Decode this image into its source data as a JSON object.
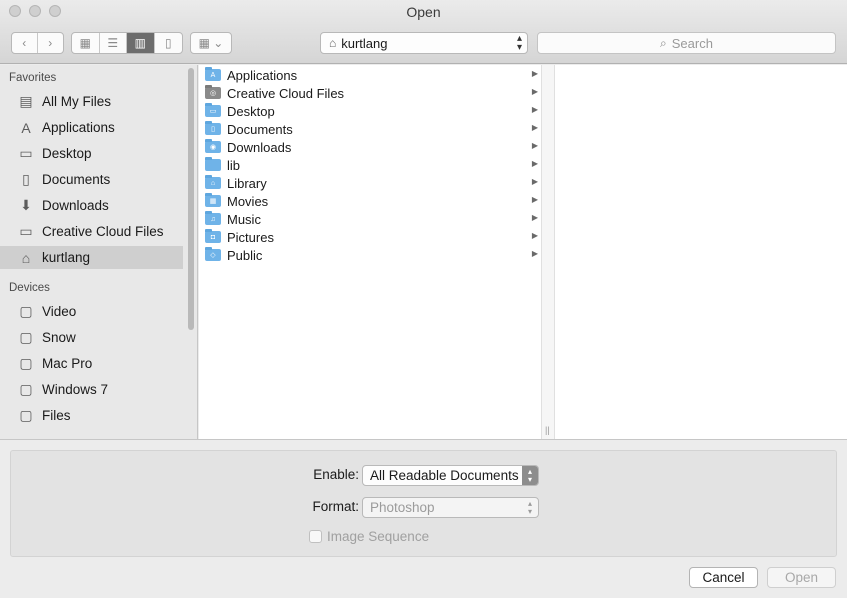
{
  "window": {
    "title": "Open"
  },
  "toolbar": {
    "back_icon": "chevron-left-icon",
    "forward_icon": "chevron-right-icon",
    "view_modes": [
      {
        "name": "icon-view",
        "glyph": "▦",
        "active": false
      },
      {
        "name": "list-view",
        "glyph": "☰",
        "active": false
      },
      {
        "name": "column-view",
        "glyph": "▥",
        "active": true
      },
      {
        "name": "cover-flow-view",
        "glyph": "▯",
        "active": false
      }
    ],
    "arrange_glyph": "▦ ⌄",
    "location": "kurtlang",
    "search_placeholder": "Search"
  },
  "sidebar": {
    "favorites_header": "Favorites",
    "favorites": [
      {
        "label": "All My Files",
        "icon": "all-files-icon",
        "glyph": "▤"
      },
      {
        "label": "Applications",
        "icon": "applications-icon",
        "glyph": "A"
      },
      {
        "label": "Desktop",
        "icon": "desktop-icon",
        "glyph": "▭"
      },
      {
        "label": "Documents",
        "icon": "documents-icon",
        "glyph": "▯"
      },
      {
        "label": "Downloads",
        "icon": "downloads-icon",
        "glyph": "⬇"
      },
      {
        "label": "Creative Cloud Files",
        "icon": "folder-icon",
        "glyph": "▭"
      },
      {
        "label": "kurtlang",
        "icon": "home-icon",
        "glyph": "⌂",
        "selected": true
      }
    ],
    "devices_header": "Devices",
    "devices": [
      {
        "label": "Video",
        "icon": "disk-icon",
        "glyph": "▢"
      },
      {
        "label": "Snow",
        "icon": "disk-icon",
        "glyph": "▢"
      },
      {
        "label": "Mac Pro",
        "icon": "disk-icon",
        "glyph": "▢"
      },
      {
        "label": "Windows 7",
        "icon": "disk-icon",
        "glyph": "▢"
      },
      {
        "label": "Files",
        "icon": "disk-icon",
        "glyph": "▢"
      }
    ]
  },
  "browser": {
    "items": [
      {
        "label": "Applications",
        "badge": "A",
        "type": "normal"
      },
      {
        "label": "Creative Cloud Files",
        "badge": "◎",
        "type": "cc"
      },
      {
        "label": "Desktop",
        "badge": "▭",
        "type": "normal"
      },
      {
        "label": "Documents",
        "badge": "▯",
        "type": "normal"
      },
      {
        "label": "Downloads",
        "badge": "◉",
        "type": "normal"
      },
      {
        "label": "lib",
        "badge": "",
        "type": "normal"
      },
      {
        "label": "Library",
        "badge": "⌂",
        "type": "normal"
      },
      {
        "label": "Movies",
        "badge": "▦",
        "type": "normal"
      },
      {
        "label": "Music",
        "badge": "♫",
        "type": "normal"
      },
      {
        "label": "Pictures",
        "badge": "◘",
        "type": "normal"
      },
      {
        "label": "Public",
        "badge": "◇",
        "type": "normal"
      }
    ],
    "chevron_glyph": "▶",
    "grip_glyph": "||"
  },
  "options": {
    "enable_label": "Enable:",
    "enable_value": "All Readable Documents",
    "format_label": "Format:",
    "format_value": "Photoshop",
    "image_sequence_label": "Image Sequence",
    "image_sequence_checked": false
  },
  "buttons": {
    "cancel": "Cancel",
    "open": "Open"
  }
}
